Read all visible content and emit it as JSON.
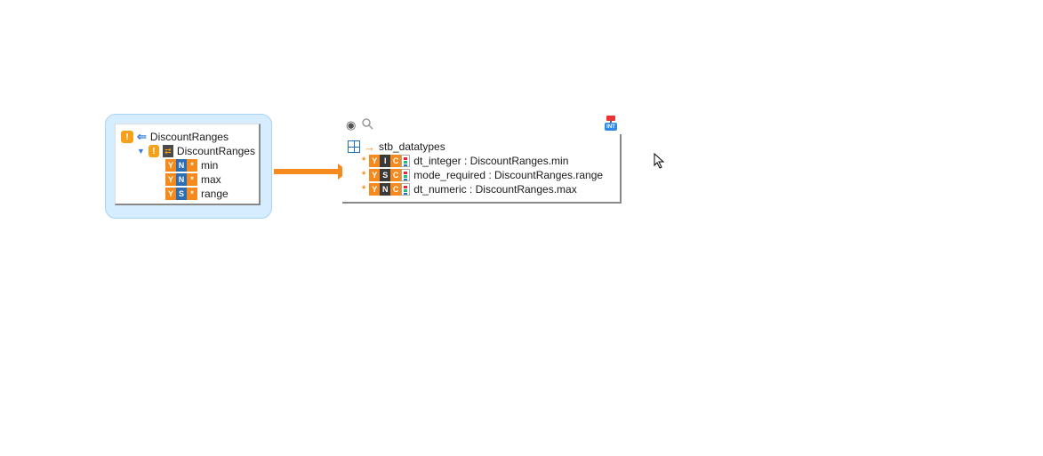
{
  "source": {
    "title": "DiscountRanges",
    "group": "DiscountRanges",
    "columns": [
      {
        "type": "N",
        "name": "min"
      },
      {
        "type": "N",
        "name": "max"
      },
      {
        "type": "S",
        "name": "range"
      }
    ]
  },
  "target": {
    "title": "stb_datatypes",
    "mappings": [
      {
        "type": "I",
        "label": "dt_integer : DiscountRanges.min"
      },
      {
        "type": "S",
        "label": "mode_required : DiscountRanges.range"
      },
      {
        "type": "N",
        "label": "dt_numeric : DiscountRanges.max"
      }
    ]
  },
  "drag": {
    "label": "INT"
  }
}
